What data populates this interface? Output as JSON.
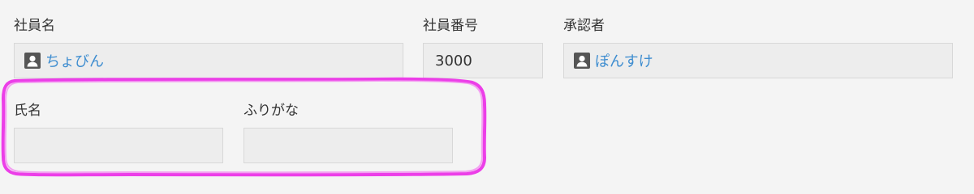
{
  "fields": {
    "employee_name": {
      "label": "社員名",
      "value": "ちょびん",
      "icon": "user-icon"
    },
    "employee_number": {
      "label": "社員番号",
      "value": "3000"
    },
    "approver": {
      "label": "承認者",
      "value": "ぽんすけ",
      "icon": "user-icon"
    },
    "full_name": {
      "label": "氏名",
      "value": ""
    },
    "furigana": {
      "label": "ふりがな",
      "value": ""
    }
  },
  "colors": {
    "background": "#f4f4f4",
    "field_background": "#ededed",
    "field_border": "#d8d8d8",
    "link": "#3e8dd0",
    "highlight": "#ec3ee8"
  }
}
